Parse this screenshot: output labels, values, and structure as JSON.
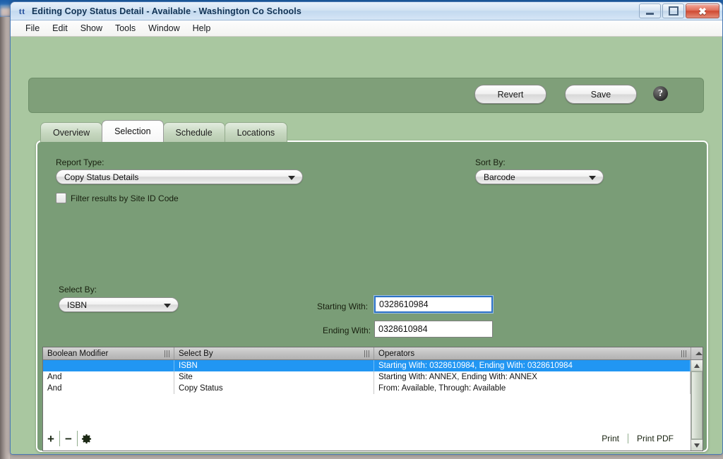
{
  "window": {
    "title": "Editing Copy Status Detail - Available - Washington Co Schools",
    "app_icon": "tt",
    "minimize": "minimize-icon",
    "maximize": "maximize-icon",
    "close": "close-icon"
  },
  "menubar": {
    "items": [
      "File",
      "Edit",
      "Show",
      "Tools",
      "Window",
      "Help"
    ]
  },
  "toolbar": {
    "revert_label": "Revert",
    "save_label": "Save",
    "help_label": "?"
  },
  "tabs": [
    {
      "label": "Overview",
      "active": false
    },
    {
      "label": "Selection",
      "active": true
    },
    {
      "label": "Schedule",
      "active": false
    },
    {
      "label": "Locations",
      "active": false
    }
  ],
  "selection": {
    "report_type_label": "Report Type:",
    "report_type_value": "Copy Status Details",
    "sort_by_label": "Sort By:",
    "sort_by_value": "Barcode",
    "filter_checkbox_label": "Filter results by Site ID Code",
    "filter_checkbox_checked": false,
    "select_by_label": "Select By:",
    "select_by_value": "ISBN",
    "starting_with_label": "Starting With:",
    "starting_with_value": "0328610984",
    "ending_with_label": "Ending With:",
    "ending_with_value": "0328610984"
  },
  "table": {
    "columns": [
      "Boolean Modifier",
      "Select By",
      "Operators"
    ],
    "rows": [
      {
        "modifier": "",
        "select_by": "ISBN",
        "operators": "Starting With: 0328610984, Ending With: 0328610984",
        "selected": true
      },
      {
        "modifier": "And",
        "select_by": "Site",
        "operators": "Starting With: ANNEX, Ending With: ANNEX",
        "selected": false
      },
      {
        "modifier": "And",
        "select_by": "Copy Status",
        "operators": "From: Available, Through: Available",
        "selected": false
      }
    ]
  },
  "footer": {
    "add_label": "+",
    "remove_label": "−",
    "settings_label": "gear",
    "print_label": "Print",
    "print_pdf_label": "Print PDF"
  },
  "colors": {
    "canvas_green": "#a9c7a0",
    "panel_green": "#7a9d77",
    "actionbar_green": "#7f9f79",
    "selection_blue": "#2196f3",
    "focus_blue": "#2d72c4"
  }
}
